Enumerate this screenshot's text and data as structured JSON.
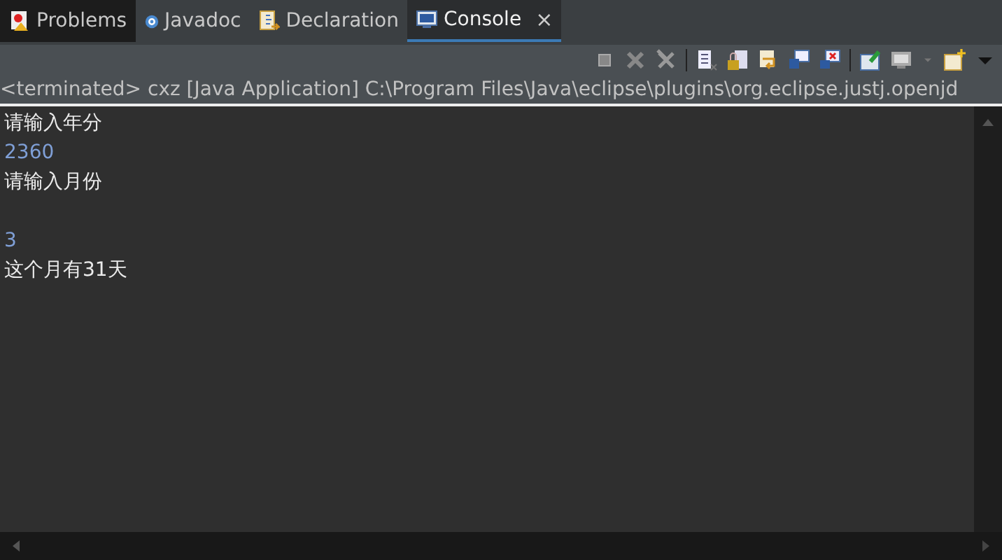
{
  "tabs": [
    {
      "label": "Problems",
      "kind": "problems",
      "selected": false
    },
    {
      "label": "Javadoc",
      "kind": "javadoc",
      "selected": false
    },
    {
      "label": "Declaration",
      "kind": "declaration",
      "selected": false
    },
    {
      "label": "Console",
      "kind": "console",
      "selected": true,
      "close": "×"
    }
  ],
  "console": {
    "header": "<terminated> cxz [Java Application] C:\\Program Files\\Java\\eclipse\\plugins\\org.eclipse.justj.openjd",
    "lines": [
      {
        "text": "请输入年分",
        "kind": "output",
        "gap_before": false
      },
      {
        "text": "2360",
        "kind": "input",
        "gap_before": false
      },
      {
        "text": "请输入月份",
        "kind": "output",
        "gap_before": false
      },
      {
        "text": "3",
        "kind": "input",
        "gap_before": true
      },
      {
        "text": "这个月有31天",
        "kind": "output",
        "gap_before": false
      }
    ]
  }
}
